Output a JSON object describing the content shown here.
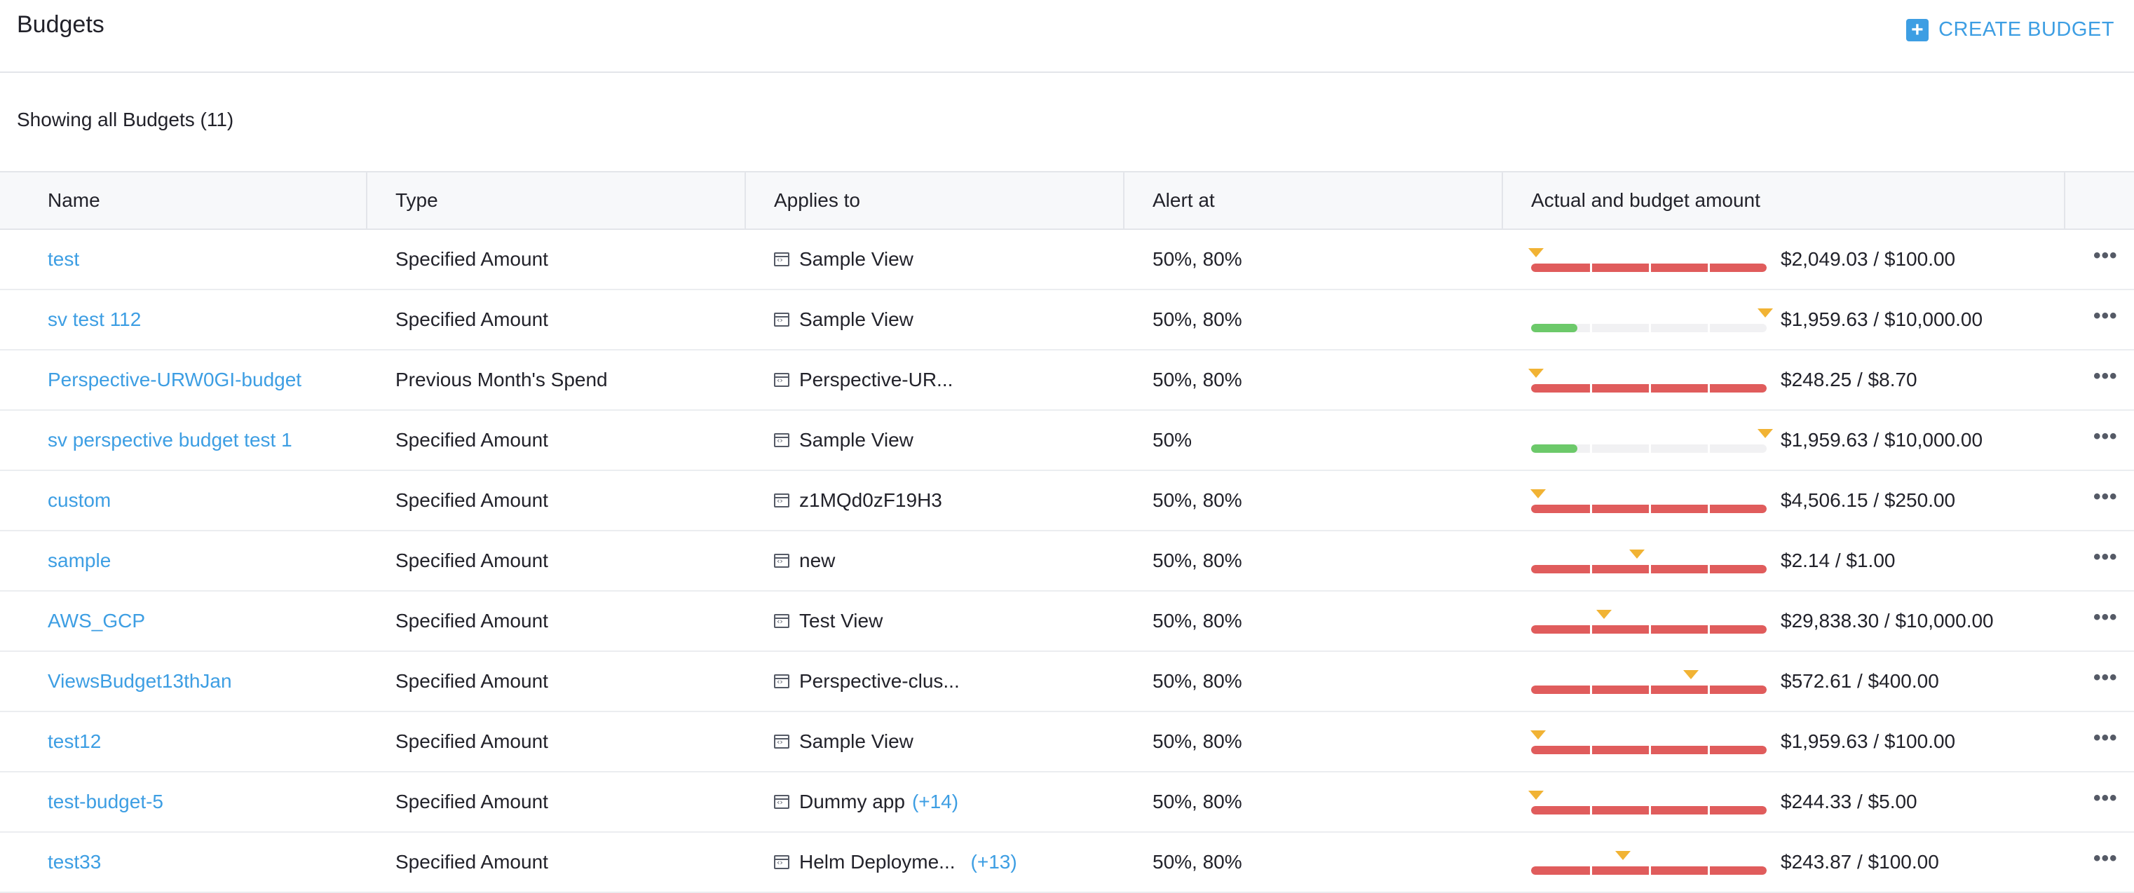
{
  "header": {
    "title": "Budgets",
    "create_label": "CREATE BUDGET"
  },
  "summary": "Showing all Budgets (11)",
  "table": {
    "columns": [
      "Name",
      "Type",
      "Applies to",
      "Alert at",
      "Actual and budget amount"
    ],
    "rows": [
      {
        "name": "test",
        "type": "Specified Amount",
        "applies_to": "Sample View",
        "extra": "",
        "alert_at": "50%, 80%",
        "amount": "$2,049.03 / $100.00",
        "fill": 1.0,
        "marker": 0.02,
        "status": "over"
      },
      {
        "name": "sv test 112",
        "type": "Specified Amount",
        "applies_to": "Sample View",
        "extra": "",
        "alert_at": "50%, 80%",
        "amount": "$1,959.63 / $10,000.00",
        "fill": 0.196,
        "marker": 0.995,
        "status": "under"
      },
      {
        "name": "Perspective-URW0GI-budget",
        "type": "Previous Month's Spend",
        "applies_to": "Perspective-UR...",
        "extra": "",
        "alert_at": "50%, 80%",
        "amount": "$248.25 / $8.70",
        "fill": 1.0,
        "marker": 0.02,
        "status": "over"
      },
      {
        "name": "sv perspective budget test 1",
        "type": "Specified Amount",
        "applies_to": "Sample View",
        "extra": "",
        "alert_at": "50%",
        "amount": "$1,959.63 / $10,000.00",
        "fill": 0.196,
        "marker": 0.995,
        "status": "under"
      },
      {
        "name": "custom",
        "type": "Specified Amount",
        "applies_to": "z1MQd0zF19H3",
        "extra": "",
        "alert_at": "50%, 80%",
        "amount": "$4,506.15 / $250.00",
        "fill": 1.0,
        "marker": 0.03,
        "status": "over"
      },
      {
        "name": "sample",
        "type": "Specified Amount",
        "applies_to": "new",
        "extra": "",
        "alert_at": "50%, 80%",
        "amount": "$2.14 / $1.00",
        "fill": 1.0,
        "marker": 0.45,
        "status": "over"
      },
      {
        "name": "AWS_GCP",
        "type": "Specified Amount",
        "applies_to": "Test View",
        "extra": "",
        "alert_at": "50%, 80%",
        "amount": "$29,838.30 / $10,000.00",
        "fill": 1.0,
        "marker": 0.31,
        "status": "over"
      },
      {
        "name": "ViewsBudget13thJan",
        "type": "Specified Amount",
        "applies_to": "Perspective-clus...",
        "extra": "",
        "alert_at": "50%, 80%",
        "amount": "$572.61 / $400.00",
        "fill": 1.0,
        "marker": 0.68,
        "status": "over"
      },
      {
        "name": "test12",
        "type": "Specified Amount",
        "applies_to": "Sample View",
        "extra": "",
        "alert_at": "50%, 80%",
        "amount": "$1,959.63 / $100.00",
        "fill": 1.0,
        "marker": 0.03,
        "status": "over"
      },
      {
        "name": "test-budget-5",
        "type": "Specified Amount",
        "applies_to": "Dummy app",
        "extra": "(+14)",
        "alert_at": "50%, 80%",
        "amount": "$244.33 / $5.00",
        "fill": 1.0,
        "marker": 0.02,
        "status": "over"
      },
      {
        "name": "test33",
        "type": "Specified Amount",
        "applies_to": "Helm Deployme...",
        "extra": "(+13)",
        "alert_at": "50%, 80%",
        "amount": "$243.87 / $100.00",
        "fill": 1.0,
        "marker": 0.39,
        "status": "over"
      }
    ]
  },
  "colors": {
    "accent": "#3d9ee3",
    "over": "#e05c5c",
    "under": "#6cc96a",
    "marker": "#f1b334"
  }
}
